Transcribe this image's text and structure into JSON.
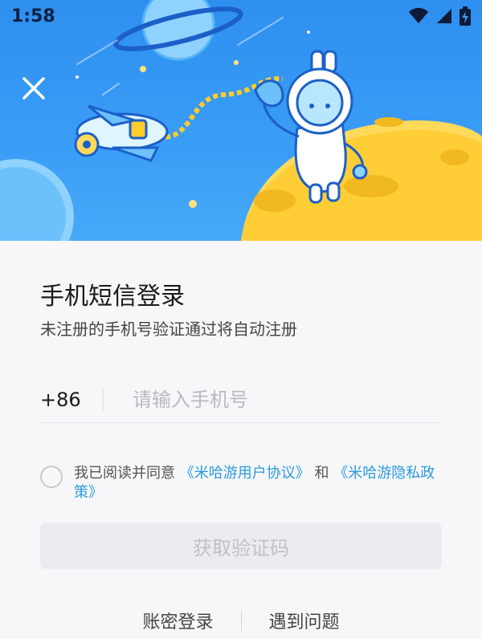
{
  "status_bar": {
    "time": "1:58",
    "icons": [
      "wifi-icon",
      "cellular-signal-icon",
      "battery-charging-icon"
    ]
  },
  "header": {
    "close_icon": "close-icon"
  },
  "login": {
    "title": "手机短信登录",
    "subtitle": "未注册的手机号验证通过将自动注册",
    "country_code": "+86",
    "phone_placeholder": "请输入手机号",
    "phone_value": "",
    "agreement": {
      "prefix": "我已阅读并同意",
      "user_agreement": "《米哈游用户协议》",
      "and": "和",
      "privacy_policy": "《米哈游隐私政策》",
      "checked": false
    },
    "get_code_label": "获取验证码"
  },
  "footer": {
    "password_login": "账密登录",
    "help": "遇到问题"
  },
  "colors": {
    "hero_blue": "#3a9df6",
    "link_blue": "#2b9bdd",
    "button_disabled_bg": "#ececf0",
    "button_disabled_text": "#c0c0c6"
  }
}
